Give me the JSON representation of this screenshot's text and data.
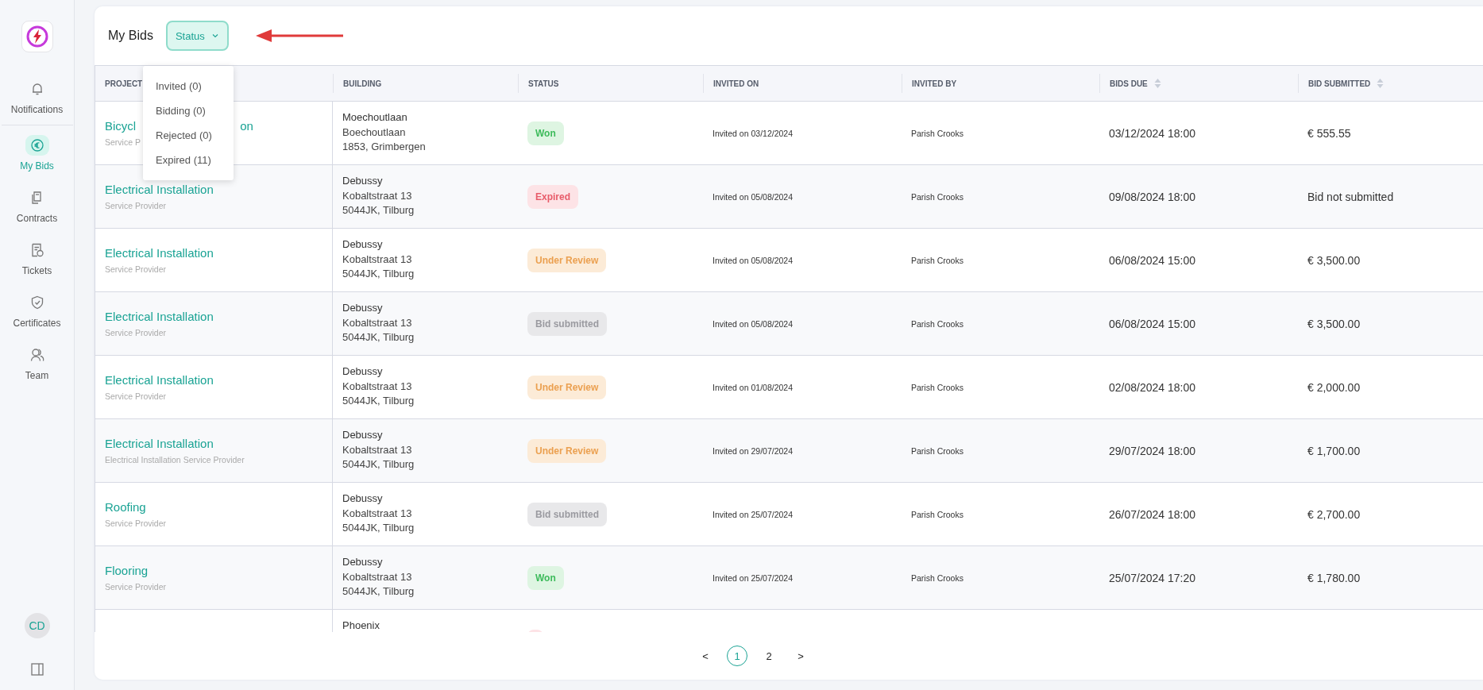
{
  "sidebar": {
    "items": [
      {
        "label": "Notifications",
        "selected": false
      },
      {
        "label": "My Bids",
        "selected": true
      },
      {
        "label": "Contracts",
        "selected": false
      },
      {
        "label": "Tickets",
        "selected": false
      },
      {
        "label": "Certificates",
        "selected": false
      },
      {
        "label": "Team",
        "selected": false
      }
    ],
    "avatar": "CD"
  },
  "page_title": "My Bids",
  "status_filter": {
    "label": "Status",
    "expanded": true,
    "options": [
      "Invited (0)",
      "Bidding (0)",
      "Rejected (0)",
      "Expired (11)"
    ]
  },
  "table": {
    "columns": [
      {
        "label": "PROJECT",
        "sortable": false
      },
      {
        "label": "BUILDING",
        "sortable": false
      },
      {
        "label": "STATUS",
        "sortable": false
      },
      {
        "label": "INVITED ON",
        "sortable": false
      },
      {
        "label": "INVITED BY",
        "sortable": false
      },
      {
        "label": "BIDS DUE",
        "sortable": true
      },
      {
        "label": "BID SUBMITTED",
        "sortable": true
      }
    ],
    "rows": [
      {
        "title_parts": [
          "Bicycl",
          "on"
        ],
        "subtitle": "Service P",
        "building": "Moechoutlaan",
        "address": [
          "Boechoutlaan",
          "1853, Grimbergen"
        ],
        "status": {
          "kind": "won",
          "label": "Won"
        },
        "invited_on": "Invited on 03/12/2024",
        "invited_by": "Parish Crooks",
        "bids_due": "03/12/2024 18:00",
        "bid_submitted": "€ 555.55"
      },
      {
        "title": "Electrical Installation",
        "subtitle": "Service Provider",
        "building": "Debussy",
        "address": [
          "Kobaltstraat 13",
          "5044JK, Tilburg"
        ],
        "status": {
          "kind": "expired",
          "label": "Expired"
        },
        "invited_on": "Invited on 05/08/2024",
        "invited_by": "Parish Crooks",
        "bids_due": "09/08/2024 18:00",
        "bid_submitted": "Bid not submitted"
      },
      {
        "title": "Electrical Installation",
        "subtitle": "Service Provider",
        "building": "Debussy",
        "address": [
          "Kobaltstraat 13",
          "5044JK, Tilburg"
        ],
        "status": {
          "kind": "under_review",
          "label": "Under Review"
        },
        "invited_on": "Invited on 05/08/2024",
        "invited_by": "Parish Crooks",
        "bids_due": "06/08/2024 15:00",
        "bid_submitted": "€ 3,500.00"
      },
      {
        "title": "Electrical Installation",
        "subtitle": "Service Provider",
        "building": "Debussy",
        "address": [
          "Kobaltstraat 13",
          "5044JK, Tilburg"
        ],
        "status": {
          "kind": "bid_submitted",
          "label": "Bid submitted"
        },
        "invited_on": "Invited on 05/08/2024",
        "invited_by": "Parish Crooks",
        "bids_due": "06/08/2024 15:00",
        "bid_submitted": "€ 3,500.00"
      },
      {
        "title": "Electrical Installation",
        "subtitle": "Service Provider",
        "building": "Debussy",
        "address": [
          "Kobaltstraat 13",
          "5044JK, Tilburg"
        ],
        "status": {
          "kind": "under_review",
          "label": "Under Review"
        },
        "invited_on": "Invited on 01/08/2024",
        "invited_by": "Parish Crooks",
        "bids_due": "02/08/2024 18:00",
        "bid_submitted": "€ 2,000.00"
      },
      {
        "title": "Electrical Installation",
        "subtitle": "Electrical Installation Service Provider",
        "building": "Debussy",
        "address": [
          "Kobaltstraat 13",
          "5044JK, Tilburg"
        ],
        "status": {
          "kind": "under_review",
          "label": "Under Review"
        },
        "invited_on": "Invited on 29/07/2024",
        "invited_by": "Parish Crooks",
        "bids_due": "29/07/2024 18:00",
        "bid_submitted": "€ 1,700.00"
      },
      {
        "title": "Roofing",
        "subtitle": "Service Provider",
        "building": "Debussy",
        "address": [
          "Kobaltstraat 13",
          "5044JK, Tilburg"
        ],
        "status": {
          "kind": "bid_submitted",
          "label": "Bid submitted"
        },
        "invited_on": "Invited on 25/07/2024",
        "invited_by": "Parish Crooks",
        "bids_due": "26/07/2024 18:00",
        "bid_submitted": "€ 2,700.00"
      },
      {
        "title": "Flooring",
        "subtitle": "Service Provider",
        "building": "Debussy",
        "address": [
          "Kobaltstraat 13",
          "5044JK, Tilburg"
        ],
        "status": {
          "kind": "won",
          "label": "Won"
        },
        "invited_on": "Invited on 25/07/2024",
        "invited_by": "Parish Crooks",
        "bids_due": "25/07/2024 17:20",
        "bid_submitted": "€ 1,780.00"
      },
      {
        "building": "Phoenix",
        "status": {
          "kind": "expired"
        }
      }
    ]
  },
  "pagination": {
    "prev": "<",
    "next": ">",
    "pages": [
      {
        "label": "1",
        "selected": true
      },
      {
        "label": "2",
        "selected": false
      }
    ]
  }
}
